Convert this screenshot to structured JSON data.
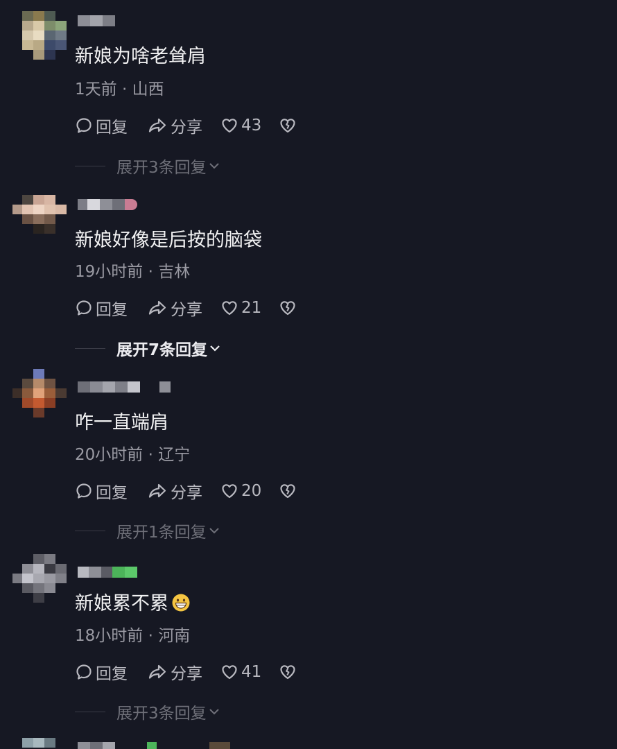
{
  "comments": [
    {
      "text": "新娘为啥老耸肩",
      "time_location": "1天前 · 山西",
      "reply_label": "回复",
      "share_label": "分享",
      "likes": "43",
      "expand_label": "展开3条回复",
      "expand_active": false
    },
    {
      "text": "新娘好像是后按的脑袋",
      "time_location": "19小时前 · 吉林",
      "reply_label": "回复",
      "share_label": "分享",
      "likes": "21",
      "expand_label": "展开7条回复",
      "expand_active": true
    },
    {
      "text": "咋一直端肩",
      "time_location": "20小时前 · 辽宁",
      "reply_label": "回复",
      "share_label": "分享",
      "likes": "20",
      "expand_label": "展开1条回复",
      "expand_active": false
    },
    {
      "text": "新娘累不累",
      "emoji": "grinning-face-emoji",
      "time_location": "18小时前 · 河南",
      "reply_label": "回复",
      "share_label": "分享",
      "likes": "41",
      "expand_label": "展开3条回复",
      "expand_active": false
    }
  ],
  "icons": {
    "reply": "comment-bubble-icon",
    "share": "share-arrow-icon",
    "like": "heart-outline-icon",
    "dislike": "broken-heart-icon",
    "expand": "chevron-down-icon"
  },
  "colors": {
    "background": "#161823",
    "text": "#f2f2f3",
    "meta": "#9a9aa3",
    "expand_dim": "#6f7079",
    "expand_active": "#ececf0"
  }
}
